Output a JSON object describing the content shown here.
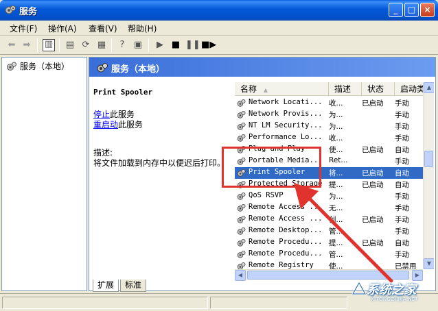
{
  "window": {
    "title": "服务",
    "minimize": "_",
    "maximize": "□",
    "close": "×"
  },
  "menu": [
    "文件(F)",
    "操作(A)",
    "查看(V)",
    "帮助(H)"
  ],
  "tree": {
    "root": "服务（本地）"
  },
  "panel": {
    "header": "服务（本地）",
    "selected_service": "Print Spooler",
    "stop_link": "停止",
    "stop_suffix": "此服务",
    "restart_link": "重启动",
    "restart_suffix": "此服务",
    "desc_label": "描述:",
    "desc_text": "将文件加载到内存中以便迟后打印。"
  },
  "list": {
    "columns": [
      "名称",
      "描述",
      "状态",
      "启动类"
    ],
    "sort_indicator": "▲",
    "rows": [
      {
        "name": "Network Locati...",
        "desc": "收...",
        "status": "已启动",
        "startup": "手动"
      },
      {
        "name": "Network Provis...",
        "desc": "为...",
        "status": "",
        "startup": "手动"
      },
      {
        "name": "NT LM Security...",
        "desc": "为...",
        "status": "",
        "startup": "手动"
      },
      {
        "name": "Performance Lo...",
        "desc": "收...",
        "status": "",
        "startup": "手动"
      },
      {
        "name": "Plug and Play",
        "desc": "使...",
        "status": "已启动",
        "startup": "自动"
      },
      {
        "name": "Portable Media...",
        "desc": "Ret...",
        "status": "",
        "startup": "手动"
      },
      {
        "name": "Print Spooler",
        "desc": "将...",
        "status": "已启动",
        "startup": "自动"
      },
      {
        "name": "Protected Storage",
        "desc": "提...",
        "status": "已启动",
        "startup": "自动"
      },
      {
        "name": "QoS RSVP",
        "desc": "为...",
        "status": "",
        "startup": "手动"
      },
      {
        "name": "Remote Access ...",
        "desc": "无...",
        "status": "",
        "startup": "手动"
      },
      {
        "name": "Remote Access ...",
        "desc": "创...",
        "status": "已启动",
        "startup": "手动"
      },
      {
        "name": "Remote Desktop...",
        "desc": "管...",
        "status": "",
        "startup": "手动"
      },
      {
        "name": "Remote Procedu...",
        "desc": "提...",
        "status": "已启动",
        "startup": "自动"
      },
      {
        "name": "Remote Procedu...",
        "desc": "管...",
        "status": "",
        "startup": "手动"
      },
      {
        "name": "Remote Registry",
        "desc": "使...",
        "status": "",
        "startup": "已禁用"
      }
    ]
  },
  "tabs": [
    "扩展",
    "标准"
  ],
  "watermark": {
    "text": "系统之家",
    "url": "XITONGZHIJIA.NET"
  },
  "colors": {
    "titlebar": "#0458d8",
    "selection": "#316ac5",
    "annotation": "#e0332e"
  }
}
